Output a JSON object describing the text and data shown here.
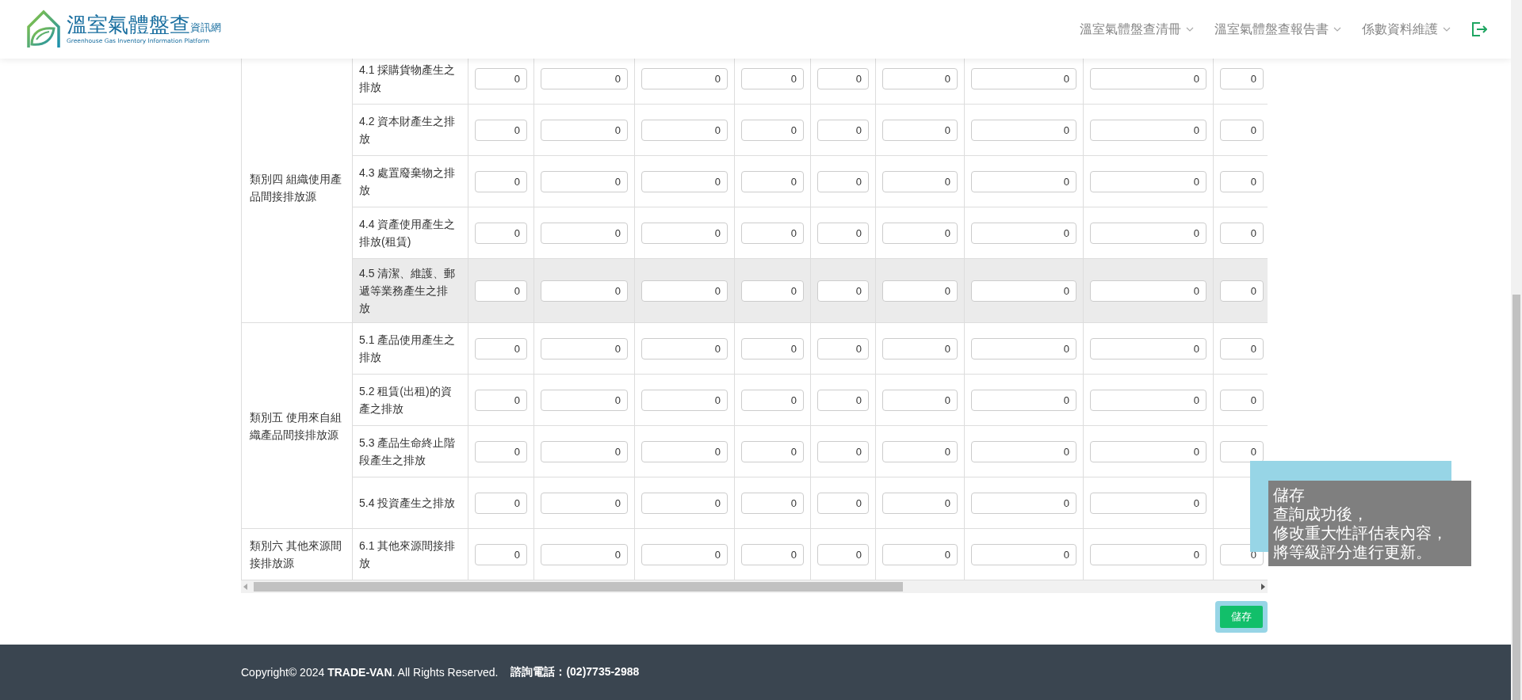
{
  "header": {
    "logo_title": "溫室氣體盤查",
    "logo_suffix": "資訊網",
    "logo_subtitle": "Greenhouse Gas Inventory Information Platform",
    "nav": [
      {
        "label": "溫室氣體盤查清冊"
      },
      {
        "label": "溫室氣體盤查報告書"
      },
      {
        "label": "係數資料維護"
      }
    ]
  },
  "table": {
    "groups": [
      {
        "label": "類別四 組織使用產品間接排放源",
        "items": [
          {
            "label": "4.1 採購貨物產生之排放",
            "highlighted": false,
            "values": [
              "0",
              "0",
              "0",
              "0",
              "0",
              "0",
              "0",
              "0",
              "0"
            ]
          },
          {
            "label": "4.2 資本財產生之排放",
            "highlighted": false,
            "values": [
              "0",
              "0",
              "0",
              "0",
              "0",
              "0",
              "0",
              "0",
              "0"
            ]
          },
          {
            "label": "4.3 處置廢棄物之排放",
            "highlighted": false,
            "values": [
              "0",
              "0",
              "0",
              "0",
              "0",
              "0",
              "0",
              "0",
              "0"
            ]
          },
          {
            "label": "4.4 資產使用產生之排放(租賃)",
            "highlighted": false,
            "values": [
              "0",
              "0",
              "0",
              "0",
              "0",
              "0",
              "0",
              "0",
              "0"
            ]
          },
          {
            "label": "4.5 清潔、維護、郵遞等業務產生之排放",
            "highlighted": true,
            "values": [
              "0",
              "0",
              "0",
              "0",
              "0",
              "0",
              "0",
              "0",
              "0"
            ]
          }
        ]
      },
      {
        "label": "類別五 使用來自組織產品間接排放源",
        "items": [
          {
            "label": "5.1 產品使用產生之排放",
            "highlighted": false,
            "values": [
              "0",
              "0",
              "0",
              "0",
              "0",
              "0",
              "0",
              "0",
              "0"
            ]
          },
          {
            "label": "5.2 租賃(出租)的資產之排放",
            "highlighted": false,
            "values": [
              "0",
              "0",
              "0",
              "0",
              "0",
              "0",
              "0",
              "0",
              "0"
            ]
          },
          {
            "label": "5.3 產品生命終止階段產生之排放",
            "highlighted": false,
            "values": [
              "0",
              "0",
              "0",
              "0",
              "0",
              "0",
              "0",
              "0",
              "0"
            ]
          },
          {
            "label": "5.4 投資產生之排放",
            "highlighted": false,
            "values": [
              "0",
              "0",
              "0",
              "0",
              "0",
              "0",
              "0",
              "0"
            ]
          }
        ]
      },
      {
        "label": "類別六 其他來源間接排放源",
        "items": [
          {
            "label": "6.1 其他來源間接排放",
            "highlighted": false,
            "values": [
              "0",
              "0",
              "0",
              "0",
              "0",
              "0",
              "0",
              "0",
              "0"
            ]
          }
        ]
      }
    ]
  },
  "save_button": "儲存",
  "tooltip": {
    "title": "儲存",
    "lines": [
      "查詢成功後，",
      "修改重大性評估表內容，",
      "將等級評分進行更新。"
    ]
  },
  "footer": {
    "copyright": "Copyright© 2024 **TRADE-VAN**. All Rights Reserved.",
    "contact": "諮詢電話：(02)7735-2988"
  }
}
